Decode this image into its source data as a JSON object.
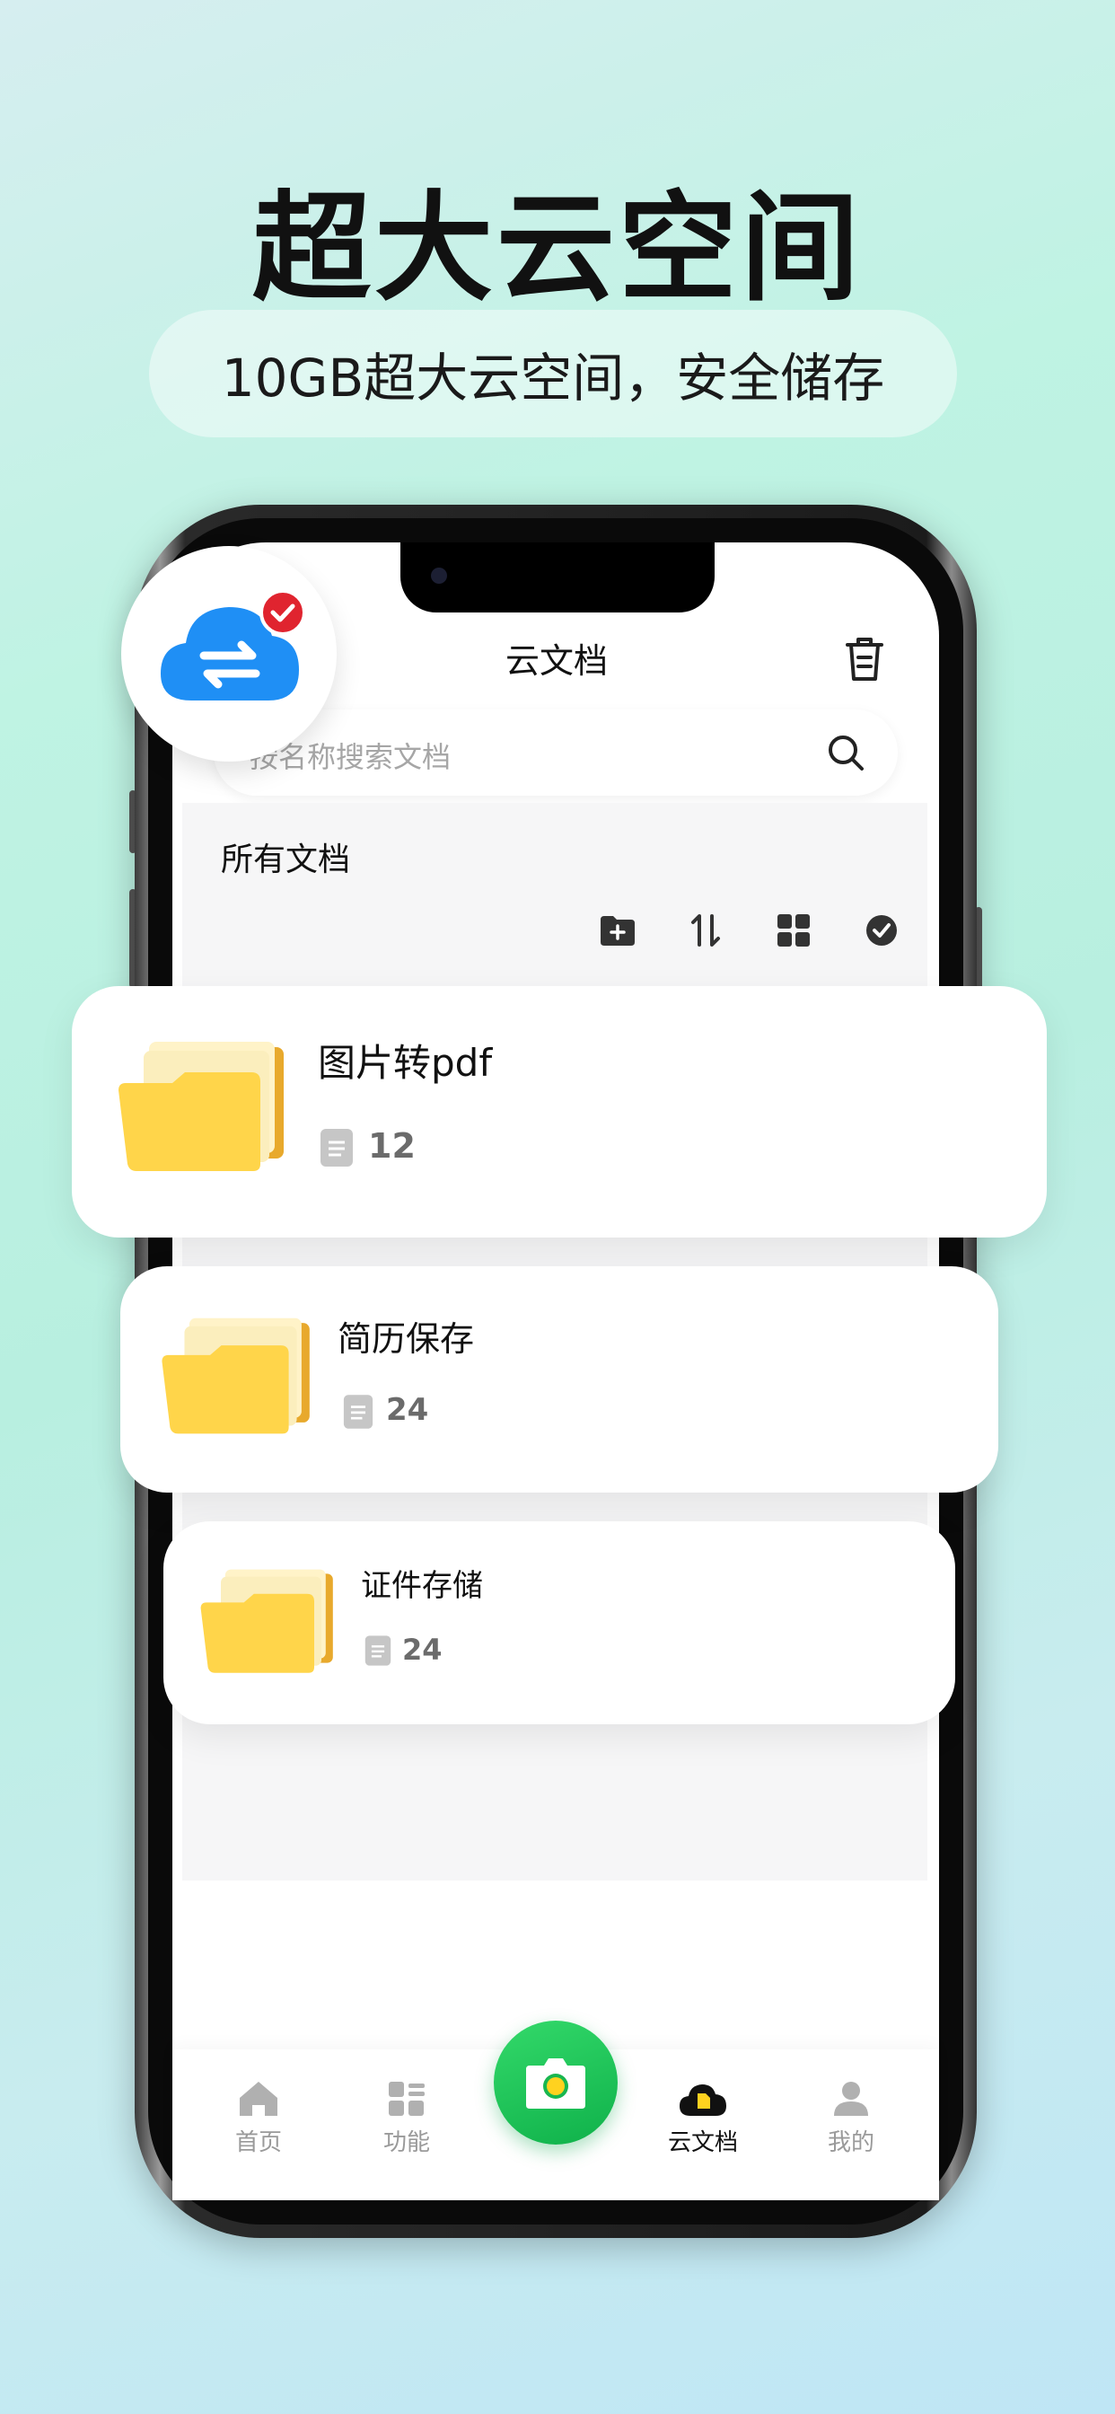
{
  "promo": {
    "headline": "超大云空间",
    "subline": "10GB超大云空间，安全储存"
  },
  "app": {
    "title": "云文档",
    "search_placeholder": "按名称搜索文档",
    "section_label": "所有文档"
  },
  "toolbar_icons": [
    "new-folder-icon",
    "sort-icon",
    "grid-view-icon",
    "select-check-icon"
  ],
  "folders": [
    {
      "name": "图片转pdf",
      "count": "12"
    },
    {
      "name": "简历保存",
      "count": "24"
    },
    {
      "name": "证件存储",
      "count": "24"
    }
  ],
  "nav": {
    "home": "首页",
    "features": "功能",
    "cloud": "云文档",
    "mine": "我的"
  },
  "colors": {
    "accent_green": "#1ec45a",
    "folder_yellow": "#ffd54a",
    "badge_blue": "#1f8ff5",
    "badge_red": "#e0242f"
  }
}
